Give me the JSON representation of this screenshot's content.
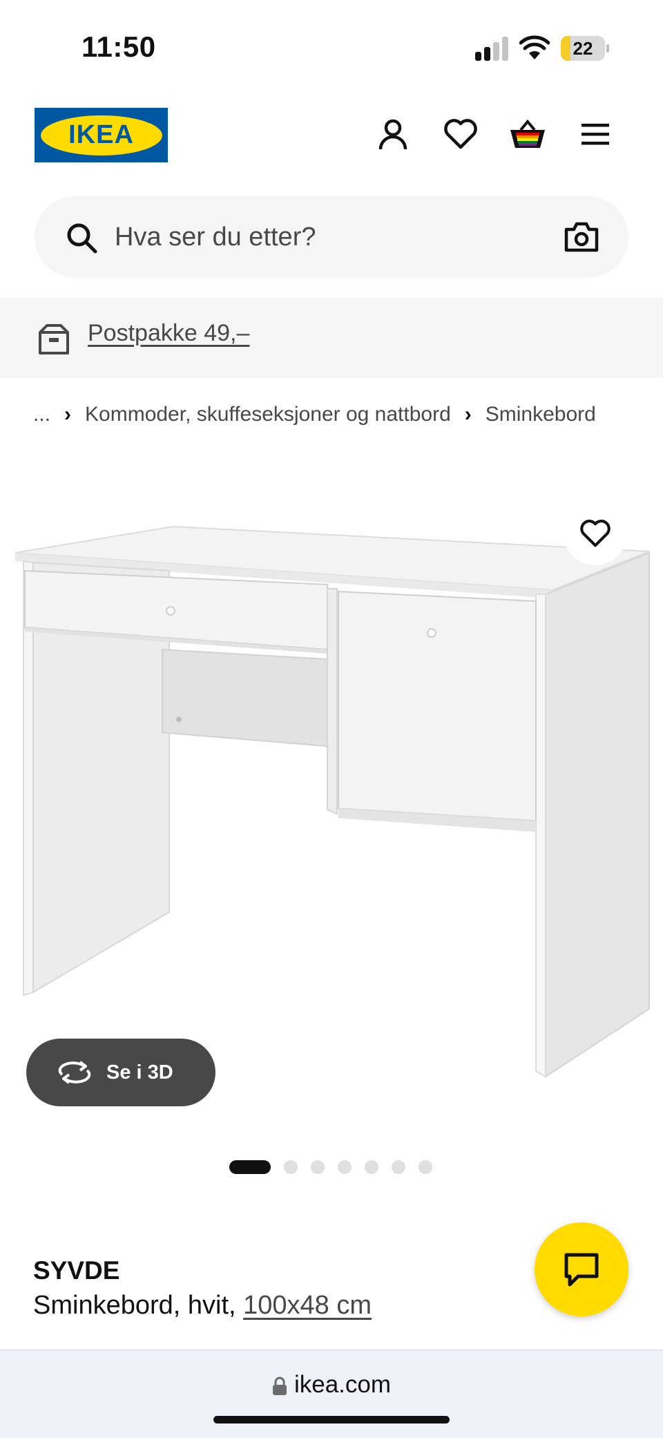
{
  "status_bar": {
    "time": "11:50",
    "battery_level": "22",
    "battery_fraction": 0.22,
    "signal_bars_active": 2
  },
  "header": {
    "logo_text": "IKEA",
    "brand_colors": {
      "blue": "#0058a3",
      "yellow": "#ffdb00"
    },
    "icons": [
      "user-icon",
      "heart-icon",
      "shopping-basket-icon",
      "menu-icon"
    ]
  },
  "search": {
    "placeholder": "Hva ser du etter?",
    "icons": [
      "search-icon",
      "camera-icon"
    ]
  },
  "delivery_banner": {
    "label": "Postpakke 49,–",
    "icon": "box-icon"
  },
  "breadcrumb": {
    "items": [
      "...",
      "Kommoder, skuffeseksjoner og nattbord",
      "Sminkebord"
    ]
  },
  "gallery": {
    "view_3d_label": "Se i 3D",
    "image_count": 7,
    "active_index": 0
  },
  "product": {
    "name": "SYVDE",
    "description": "Sminkebord, hvit, ",
    "dimensions": "100x48 cm"
  },
  "browser": {
    "url": "ikea.com"
  }
}
